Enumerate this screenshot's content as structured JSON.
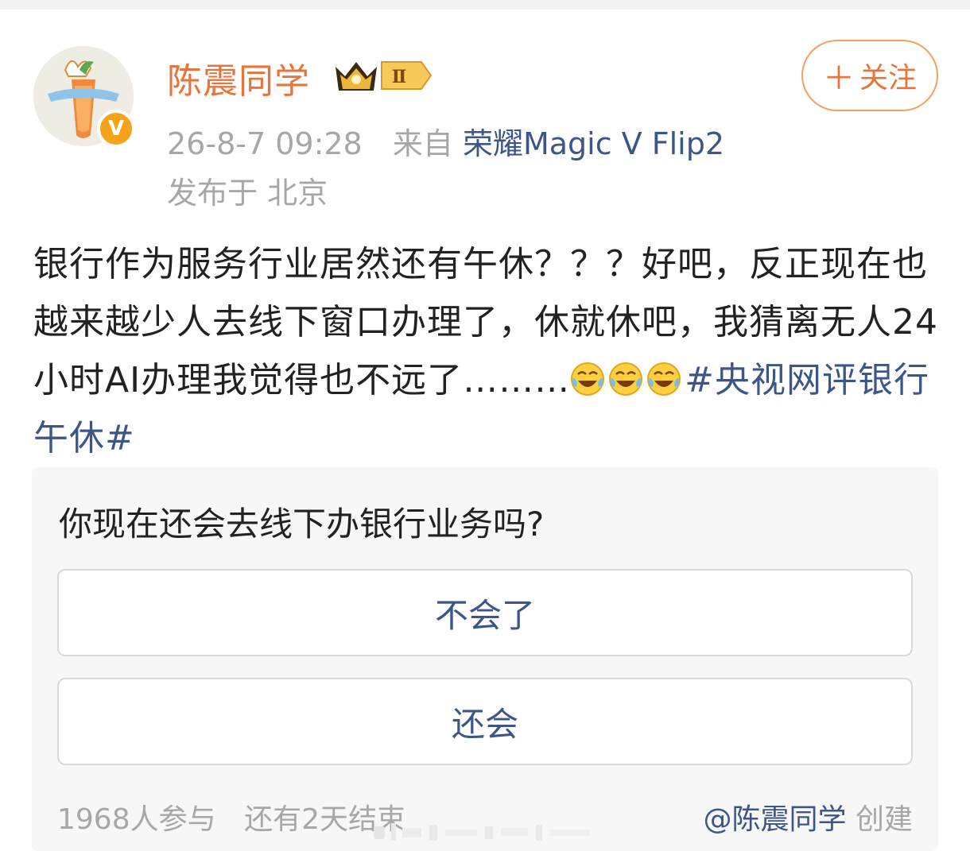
{
  "post": {
    "username": "陈震同学",
    "level_badge": "Ⅱ",
    "verified_badge": "V",
    "follow_button": {
      "icon": "plus-icon",
      "label": "关注"
    },
    "time": "26-8-7 09:28",
    "source_prefix": "来自",
    "device": "荣耀Magic V Flip2",
    "location": "发布于 北京",
    "text_main": "银行作为服务行业居然还有午休？？？好吧，反正现在也越来越少人去线下窗口办理了，休就休吧，我猜离无人24小时AI办理我觉得也不远了………",
    "emojis": [
      "laugh-cry-emoji",
      "laugh-cry-emoji",
      "laugh-cry-emoji"
    ],
    "hashtag": "#央视网评银行午休#"
  },
  "poll": {
    "question": "你现在还会去线下办银行业务吗?",
    "options": [
      "不会了",
      "还会"
    ],
    "participants": "1968人参与",
    "remaining": "还有2天结束",
    "creator_mention": "@陈震同学",
    "creator_suffix": "创建"
  },
  "colors": {
    "username": "#e8743b",
    "link": "#3d5688",
    "meta": "#a7a7a7",
    "follow_border": "#f2a15f",
    "verified": "#f7a21b",
    "poll_bg": "#f7f7f7"
  }
}
